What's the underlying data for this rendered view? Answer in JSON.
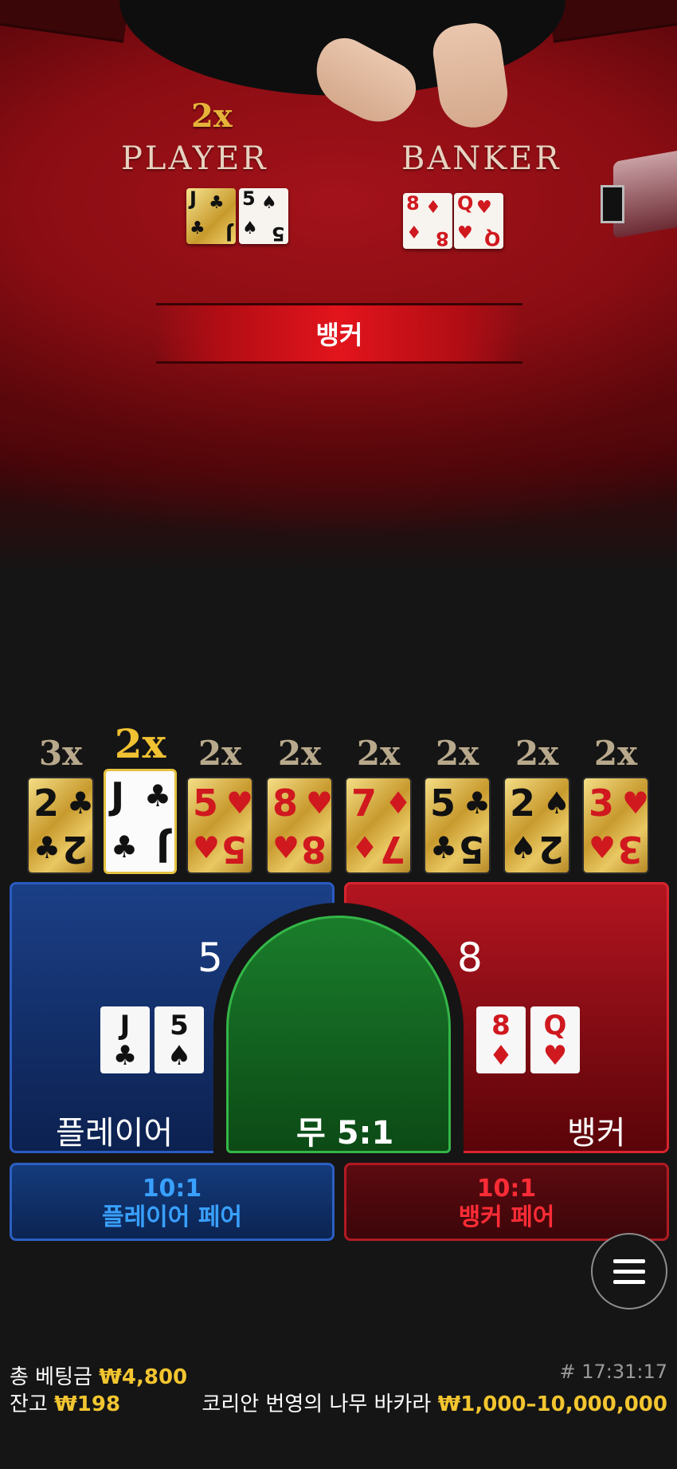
{
  "table": {
    "player_label": "PLAYER",
    "banker_label": "BANKER",
    "multiplier": "2x",
    "result": "뱅커",
    "player_cards": [
      {
        "rank": "J",
        "suit": "♣",
        "gold": true
      },
      {
        "rank": "5",
        "suit": "♠",
        "gold": false
      }
    ],
    "banker_cards": [
      {
        "rank": "8",
        "suit": "♦"
      },
      {
        "rank": "Q",
        "suit": "♥"
      }
    ]
  },
  "road": [
    {
      "mult": "3x",
      "rank": "2",
      "suit": "♣",
      "color": "black",
      "active": false
    },
    {
      "mult": "2x",
      "rank": "J",
      "suit": "♣",
      "color": "black",
      "active": true
    },
    {
      "mult": "2x",
      "rank": "5",
      "suit": "♥",
      "color": "red",
      "active": false
    },
    {
      "mult": "2x",
      "rank": "8",
      "suit": "♥",
      "color": "red",
      "active": false
    },
    {
      "mult": "2x",
      "rank": "7",
      "suit": "♦",
      "color": "red",
      "active": false
    },
    {
      "mult": "2x",
      "rank": "5",
      "suit": "♣",
      "color": "black",
      "active": false
    },
    {
      "mult": "2x",
      "rank": "2",
      "suit": "♠",
      "color": "black",
      "active": false
    },
    {
      "mult": "2x",
      "rank": "3",
      "suit": "♥",
      "color": "red",
      "active": false
    }
  ],
  "bets": {
    "player": {
      "label": "플레이어",
      "score": "5",
      "cards": [
        {
          "rank": "J",
          "suit": "♣"
        },
        {
          "rank": "5",
          "suit": "♠"
        }
      ]
    },
    "banker": {
      "label": "뱅커",
      "score": "8",
      "cards": [
        {
          "rank": "8",
          "suit": "♦"
        },
        {
          "rank": "Q",
          "suit": "♥"
        }
      ]
    },
    "tie": {
      "label": "무 5:1"
    },
    "player_pair": {
      "odds": "10:1",
      "label": "플레이어 페어"
    },
    "banker_pair": {
      "odds": "10:1",
      "label": "뱅커 페어"
    }
  },
  "footer": {
    "total_bet_label": "총 베팅금",
    "total_bet_value": "₩4,800",
    "balance_label": "잔고",
    "balance_value": "₩198",
    "game_time": "# 17:31:17",
    "table_name": "코리안 번영의 나무 바카라",
    "limits": "₩1,000–10,000,000"
  },
  "colors": {
    "gold": "#f2c530",
    "player_blue": "#1b3f86",
    "banker_red": "#b31520",
    "tie_green": "#1a7d2b"
  },
  "icons": {
    "menu": "hamburger-menu-icon"
  }
}
